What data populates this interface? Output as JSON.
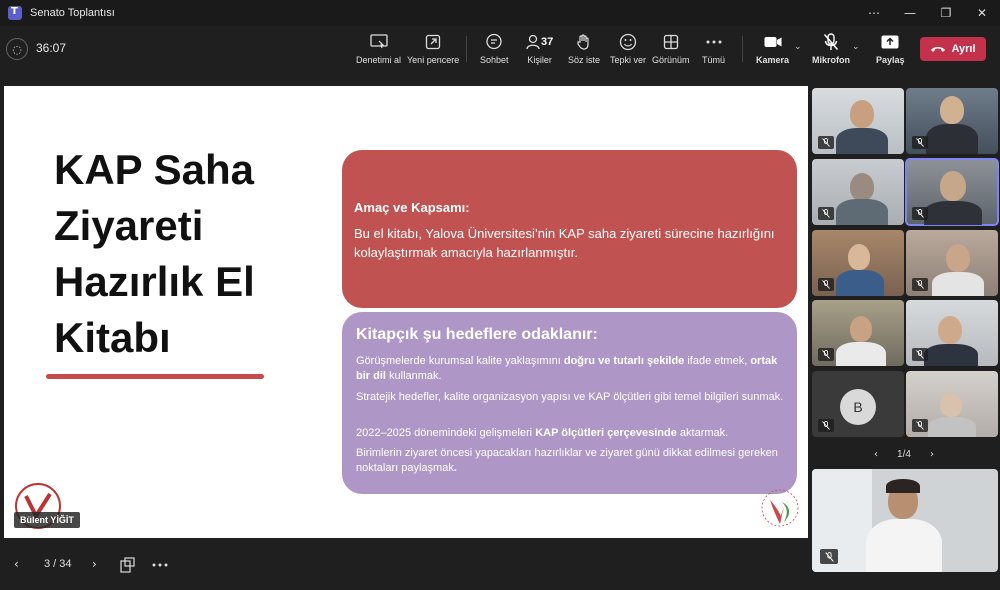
{
  "window": {
    "title": "Senato Toplantısı"
  },
  "toolbar": {
    "timer": "36:07",
    "people_count": "37",
    "buttons": {
      "take_control": "Denetimi al",
      "new_window": "Yeni pencere",
      "chat": "Sohbet",
      "people": "Kişiler",
      "raise_hand": "Söz iste",
      "react": "Tepki ver",
      "view": "Görünüm",
      "more": "Tümü",
      "camera": "Kamera",
      "mic": "Mikrofon",
      "share": "Paylaş",
      "leave": "Ayrıl"
    }
  },
  "slide": {
    "title_lines": [
      "KAP Saha",
      "Ziyareti",
      "Hazırlık El",
      "Kitabı"
    ],
    "box1": {
      "heading": "Amaç ve Kapsamı:",
      "text": "Bu el kitabı, Yalova Üniversitesi’nin KAP saha ziyareti sürecine hazırlığını kolaylaştırmak amacıyla hazırlanmıştır."
    },
    "box2": {
      "heading": "Kitapçık şu hedeflere odaklanır:",
      "b1_pre": "Görüşmelerde kurumsal kalite yaklaşımını ",
      "b1_bold1": "doğru ve tutarlı şekilde",
      "b1_mid": " ifade etmek, ",
      "b1_bold2": "ortak bir dil",
      "b1_post": " kullanmak.",
      "b2": "Stratejik hedefler, kalite organizasyon yapısı ve KAP ölçütleri gibi temel bilgileri sunmak.",
      "b3_pre": "2022–2025 dönemindeki gelişmeleri ",
      "b3_bold": "KAP ölçütleri çerçevesinde",
      "b3_post": " aktarmak.",
      "b4": "Birimlerin ziyaret öncesi yapacakları hazırlıklar ve ziyaret günü dikkat edilmesi gereken noktaları paylaşmak",
      "b4_end": "."
    }
  },
  "presenter": {
    "name": "Bülent YİĞİT"
  },
  "slide_nav": {
    "page": "3 / 34"
  },
  "gallery": {
    "pager": "1/4",
    "avatar_initial": "B"
  },
  "colors": {
    "leave": "#c4314b",
    "box1": "#c05352",
    "box2": "#ae97c7",
    "accent_underline": "#c94a4a",
    "selected_tile": "#7f85f5"
  }
}
